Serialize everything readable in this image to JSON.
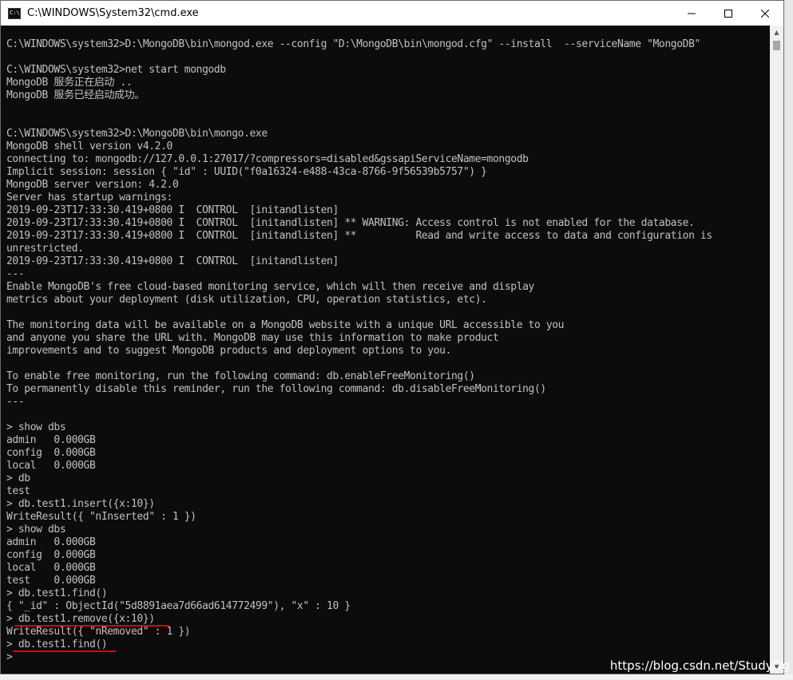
{
  "window": {
    "title": "C:\\WINDOWS\\System32\\cmd.exe"
  },
  "icons": {
    "app": "cmd-icon",
    "minimize": "minimize-icon",
    "maximize": "maximize-icon",
    "close": "close-icon"
  },
  "console": {
    "lines": [
      "C:\\WINDOWS\\system32>D:\\MongoDB\\bin\\mongod.exe --config \"D:\\MongoDB\\bin\\mongod.cfg\" --install  --serviceName \"MongoDB\"",
      "",
      "C:\\WINDOWS\\system32>net start mongodb",
      "MongoDB 服务正在启动 ..",
      "MongoDB 服务已经启动成功。",
      "",
      "",
      "C:\\WINDOWS\\system32>D:\\MongoDB\\bin\\mongo.exe",
      "MongoDB shell version v4.2.0",
      "connecting to: mongodb://127.0.0.1:27017/?compressors=disabled&gssapiServiceName=mongodb",
      "Implicit session: session { \"id\" : UUID(\"f0a16324-e488-43ca-8766-9f56539b5757\") }",
      "MongoDB server version: 4.2.0",
      "Server has startup warnings:",
      "2019-09-23T17:33:30.419+0800 I  CONTROL  [initandlisten]",
      "2019-09-23T17:33:30.419+0800 I  CONTROL  [initandlisten] ** WARNING: Access control is not enabled for the database.",
      "2019-09-23T17:33:30.419+0800 I  CONTROL  [initandlisten] **          Read and write access to data and configuration is",
      "unrestricted.",
      "2019-09-23T17:33:30.419+0800 I  CONTROL  [initandlisten]",
      "---",
      "Enable MongoDB's free cloud-based monitoring service, which will then receive and display",
      "metrics about your deployment (disk utilization, CPU, operation statistics, etc).",
      "",
      "The monitoring data will be available on a MongoDB website with a unique URL accessible to you",
      "and anyone you share the URL with. MongoDB may use this information to make product",
      "improvements and to suggest MongoDB products and deployment options to you.",
      "",
      "To enable free monitoring, run the following command: db.enableFreeMonitoring()",
      "To permanently disable this reminder, run the following command: db.disableFreeMonitoring()",
      "---",
      "",
      "> show dbs",
      "admin   0.000GB",
      "config  0.000GB",
      "local   0.000GB",
      "> db",
      "test",
      "> db.test1.insert({x:10})",
      "WriteResult({ \"nInserted\" : 1 })",
      "> show dbs",
      "admin   0.000GB",
      "config  0.000GB",
      "local   0.000GB",
      "test    0.000GB",
      "> db.test1.find()",
      "{ \"_id\" : ObjectId(\"5d8891aea7d66ad614772499\"), \"x\" : 10 }",
      "> db.test1.remove({x:10})",
      "WriteResult({ \"nRemoved\" : 1 })",
      "> db.test1.find()",
      ">"
    ]
  },
  "watermark": "https://blog.csdn.net/StudyOg",
  "colors": {
    "console_bg": "#0c0c0c",
    "console_text": "#c0c0c0",
    "annotation": "#e00000"
  }
}
